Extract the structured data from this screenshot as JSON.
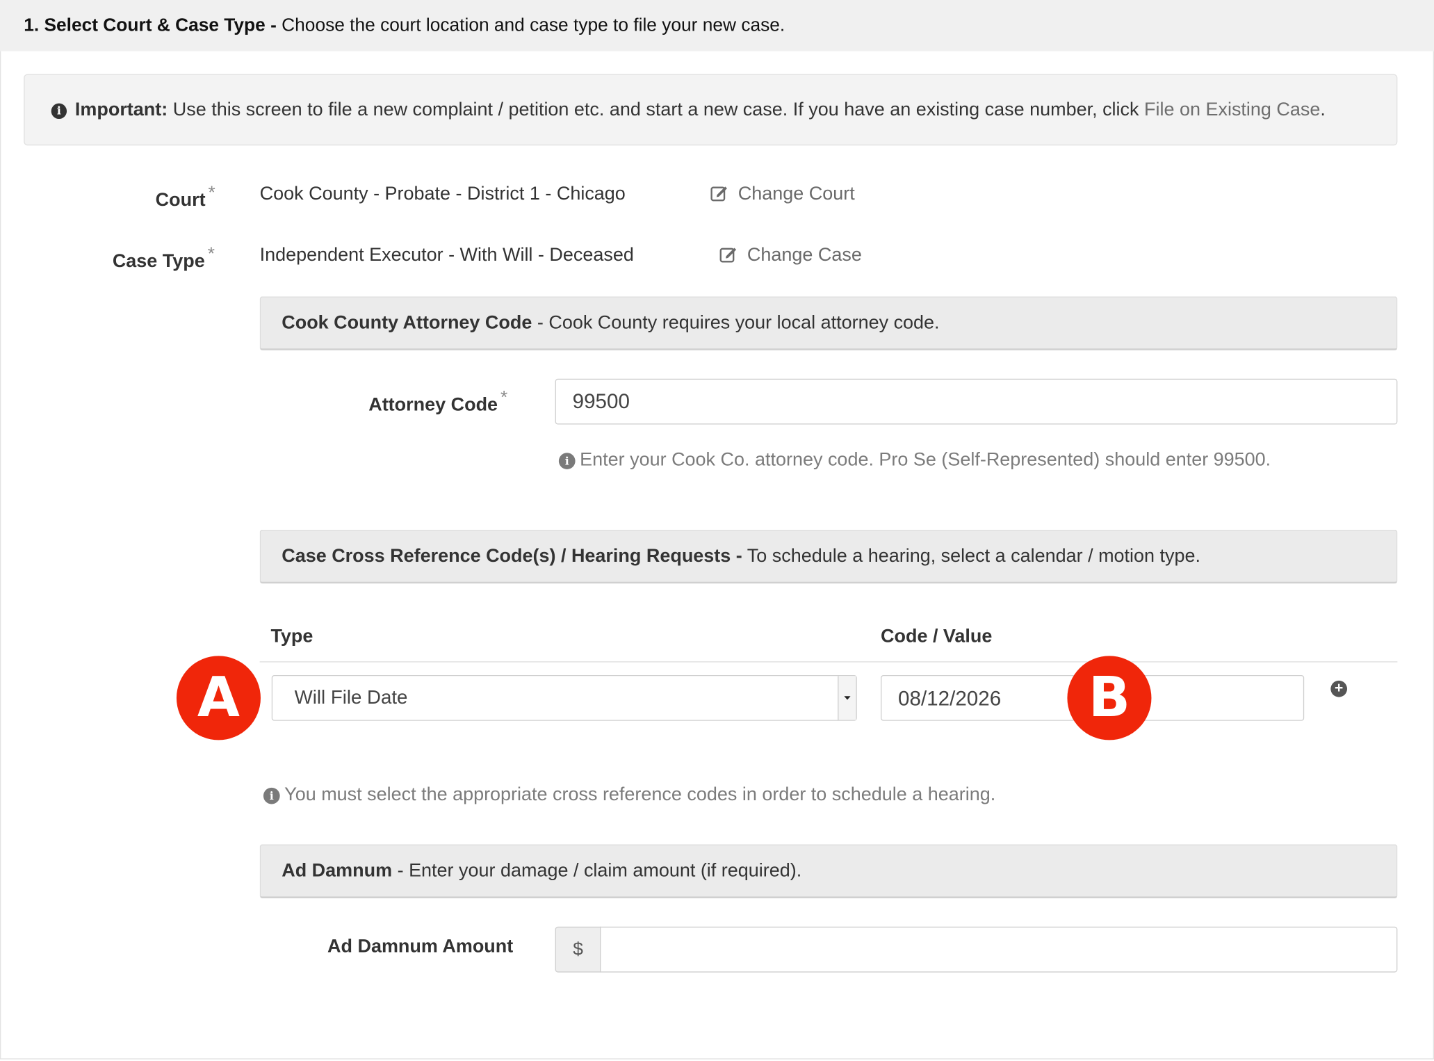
{
  "header": {
    "step_title": "1. Select Court & Case Type -",
    "step_description": "Choose the court location and case type to file your new case."
  },
  "alert": {
    "icon": "info-circle-icon",
    "title": "Important:",
    "text": "Use this screen to file a new complaint / petition etc. and start a new case. If you have an existing case number, click",
    "link_label": "File on Existing Case",
    "trailing": "."
  },
  "court": {
    "label": "Court",
    "required_mark": "*",
    "value": "Cook County - Probate - District 1 - Chicago",
    "change_label": "Change Court",
    "change_icon": "edit-icon"
  },
  "case_type": {
    "label": "Case Type",
    "required_mark": "*",
    "value": "Independent Executor - With Will - Deceased",
    "change_label": "Change Case",
    "change_icon": "edit-icon"
  },
  "attorney_section": {
    "title": "Cook County Attorney Code",
    "description": "- Cook County requires your local attorney code.",
    "field_label": "Attorney Code",
    "required_mark": "*",
    "field_value": "99500",
    "help_icon": "info-circle-icon",
    "help_text": "Enter your Cook Co. attorney code. Pro Se (Self-Represented) should enter 99500."
  },
  "cross_ref_section": {
    "title": "Case Cross Reference Code(s) / Hearing Requests -",
    "description": "To schedule a hearing, select a calendar / motion type.",
    "columns": [
      "Type",
      "Code / Value"
    ],
    "rows": [
      {
        "type": "Will File Date",
        "code_value": "08/12/2026"
      }
    ],
    "add_icon": "plus-circle-icon",
    "help_icon": "info-circle-icon",
    "help_text": "You must select the appropriate cross reference codes in order to schedule a hearing."
  },
  "annotations": {
    "badge_a": "A",
    "badge_b": "B",
    "badge_color": "#f0260a"
  },
  "ad_damnum_section": {
    "title": "Ad Damnum",
    "description": "- Enter your damage / claim amount (if required).",
    "field_label": "Ad Damnum Amount",
    "currency_symbol": "$",
    "field_value": ""
  }
}
